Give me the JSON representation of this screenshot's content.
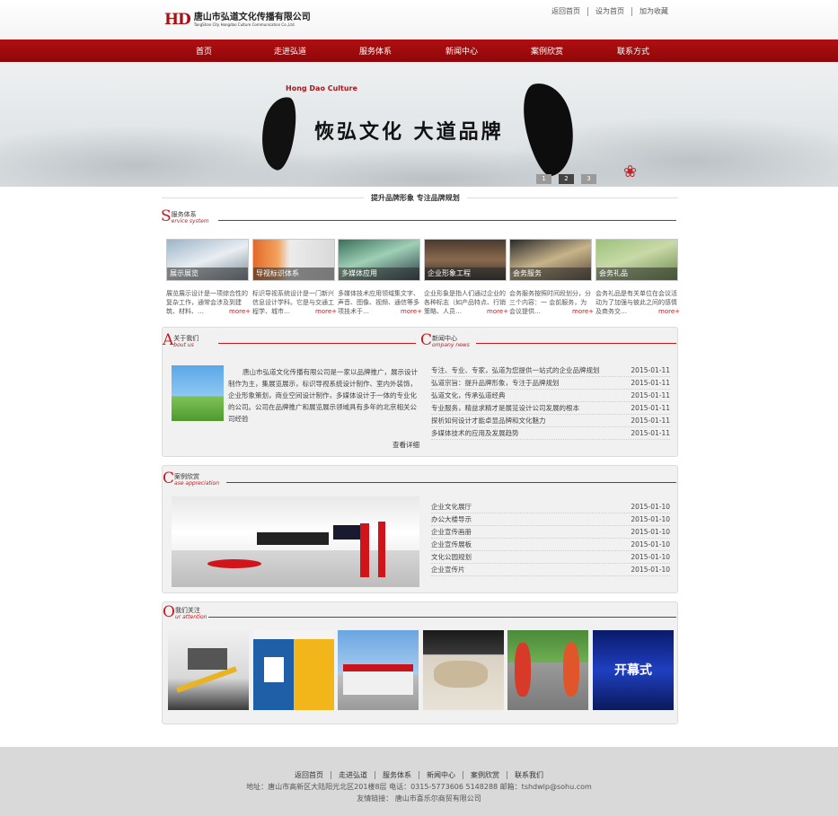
{
  "header": {
    "logo_mark": "HD",
    "company_cn": "唐山市弘道文化传播有限公司",
    "company_en": "TangShan City Hongdao Culture Communication Co.,Ltd.",
    "top_links": [
      "返回首页",
      "设为首页",
      "加为收藏"
    ]
  },
  "nav": [
    "首页",
    "走进弘道",
    "服务体系",
    "新闻中心",
    "案例欣赏",
    "联系方式"
  ],
  "banner": {
    "english": "Hong Dao Culture",
    "title": "恢弘文化  大道品牌",
    "pager": [
      "1",
      "2",
      "3"
    ],
    "active_page": "2"
  },
  "slogan": "提升品牌形象   专注品牌规划",
  "services": {
    "letter": "S",
    "title_cn": "服务体系",
    "title_en": "ervice system",
    "items": [
      {
        "label": "展示展览",
        "desc": "展览展示设计是一项综合性的复杂工作，通常会涉及到建筑、材料、…",
        "more": "more+"
      },
      {
        "label": "导视标识体系",
        "desc": "标识导视系统设计是一门新兴信息设计学科。它是与交通工程学、城市…",
        "more": "more+"
      },
      {
        "label": "多媒体应用",
        "desc": "多媒体技术应用领域集文字、声音、图像、视频、通信等多项技术于…",
        "more": "more+"
      },
      {
        "label": "企业形象工程",
        "desc": "企业形象是指人们通过企业的各种标志（如产品特点、行销策略、人员…",
        "more": "more+"
      },
      {
        "label": "会务服务",
        "desc": "会务服务按照时间段划分，分三个内容：一 会前服务，为会议提供…",
        "more": "more+"
      },
      {
        "label": "会务礼品",
        "desc": "会务礼品是有关单位在会议活动为了加强与彼此之间的感情及商务交…",
        "more": "more+"
      }
    ]
  },
  "about": {
    "letter": "A",
    "title_cn": "关于我们",
    "title_en": "bout us",
    "text": "唐山市弘道文化传播有限公司是一家以品牌推广，展示设计制作为主，集展览展示，标识导视系统设计制作、室内外装饰，企业形象策划，商业空间设计制作，多媒体设计于一体的专业化的公司。公司在品牌推广和展览展示领域具有多年的北京相关公司经验",
    "more": "查看详细"
  },
  "news": {
    "letter": "C",
    "title_cn": "新闻中心",
    "title_en": "ompany news",
    "items": [
      {
        "title": "专注、专业、专家，弘道为您提供一站式的企业品牌规划",
        "date": "2015-01-11"
      },
      {
        "title": "弘道宗旨：提升品牌形象，专注于品牌规划",
        "date": "2015-01-11"
      },
      {
        "title": "弘道文化，传承弘道经典",
        "date": "2015-01-11"
      },
      {
        "title": "专业服务，精益求精才是展览设计公司发展的根本",
        "date": "2015-01-11"
      },
      {
        "title": "探析如何设计才能卓显品牌和文化魅力",
        "date": "2015-01-11"
      },
      {
        "title": "多媒体技术的应用及发展趋势",
        "date": "2015-01-11"
      }
    ]
  },
  "cases": {
    "letter": "C",
    "title_cn": "案例欣赏",
    "title_en": "ase appreciation",
    "items": [
      {
        "title": "企业文化展厅",
        "date": "2015-01-10"
      },
      {
        "title": "办公大楼导示",
        "date": "2015-01-10"
      },
      {
        "title": "企业宣传画册",
        "date": "2015-01-10"
      },
      {
        "title": "企业宣传展板",
        "date": "2015-01-10"
      },
      {
        "title": "文化公园规划",
        "date": "2015-01-10"
      },
      {
        "title": "企业宣传片",
        "date": "2015-01-10"
      }
    ]
  },
  "follow": {
    "letter": "O",
    "title_cn": "我们关注",
    "title_en": "ur attention",
    "stage_text": "开幕式"
  },
  "footer": {
    "links": [
      "返回首页",
      "走进弘道",
      "服务体系",
      "新闻中心",
      "案例欣赏",
      "联系我们"
    ],
    "address": "地址：唐山市高新区大陆阳光北区201楼8层    电话：0315-5773606 5148288    邮箱：tshdwlp@sohu.com",
    "friends": "友情链接：  唐山市喜乐尔商贸有限公司"
  },
  "colors": {
    "brand_red": "#b10f11",
    "accent_red": "#c41a1e",
    "footer_bg": "#d9d9d9"
  }
}
